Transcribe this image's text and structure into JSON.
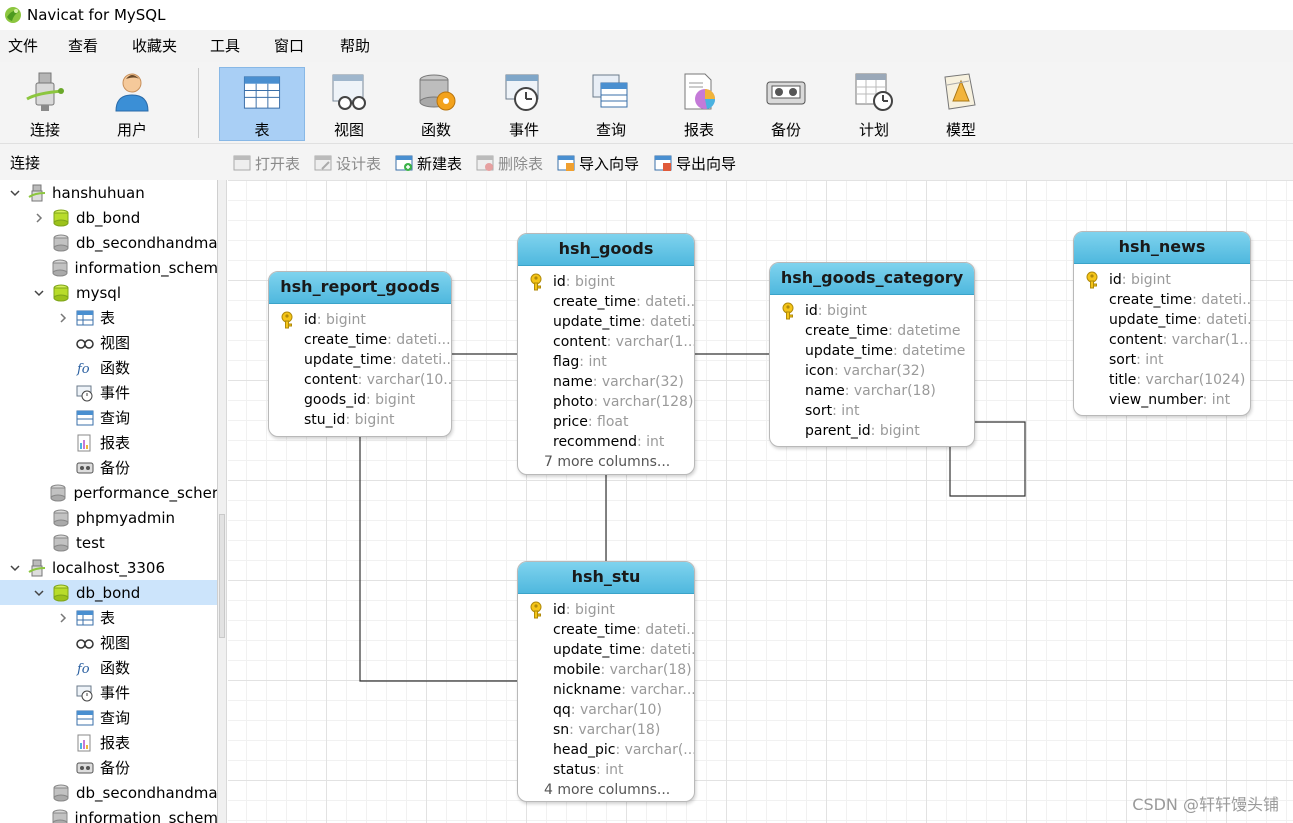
{
  "window": {
    "title": "Navicat for MySQL"
  },
  "menu": [
    "文件",
    "查看",
    "收藏夹",
    "工具",
    "窗口",
    "帮助"
  ],
  "toolbar": [
    {
      "label": "连接",
      "icon": "connection-icon",
      "active": false
    },
    {
      "label": "用户",
      "icon": "user-icon",
      "active": false
    },
    {
      "label": "表",
      "icon": "table-icon",
      "active": true
    },
    {
      "label": "视图",
      "icon": "view-icon",
      "active": false
    },
    {
      "label": "函数",
      "icon": "function-icon",
      "active": false
    },
    {
      "label": "事件",
      "icon": "event-icon",
      "active": false
    },
    {
      "label": "查询",
      "icon": "query-icon",
      "active": false
    },
    {
      "label": "报表",
      "icon": "report-icon",
      "active": false
    },
    {
      "label": "备份",
      "icon": "backup-icon",
      "active": false
    },
    {
      "label": "计划",
      "icon": "schedule-icon",
      "active": false
    },
    {
      "label": "模型",
      "icon": "model-icon",
      "active": false
    }
  ],
  "subbar": {
    "connection_label": "连接",
    "actions": [
      {
        "label": "打开表",
        "enabled": false
      },
      {
        "label": "设计表",
        "enabled": false
      },
      {
        "label": "新建表",
        "enabled": true
      },
      {
        "label": "删除表",
        "enabled": false
      },
      {
        "label": "导入向导",
        "enabled": true
      },
      {
        "label": "导出向导",
        "enabled": true
      }
    ]
  },
  "tree": [
    {
      "label": "hanshuhuan",
      "type": "connection",
      "arrow": "down"
    },
    {
      "label": "db_bond",
      "type": "db-open",
      "arrow": "right"
    },
    {
      "label": "db_secondhandma",
      "type": "db",
      "arrow": ""
    },
    {
      "label": "information_schem",
      "type": "db",
      "arrow": ""
    },
    {
      "label": "mysql",
      "type": "db-open",
      "arrow": "down"
    },
    {
      "label": "表",
      "type": "table",
      "arrow": "right"
    },
    {
      "label": "视图",
      "type": "view",
      "arrow": ""
    },
    {
      "label": "函数",
      "type": "function",
      "arrow": ""
    },
    {
      "label": "事件",
      "type": "event",
      "arrow": ""
    },
    {
      "label": "查询",
      "type": "query",
      "arrow": ""
    },
    {
      "label": "报表",
      "type": "report",
      "arrow": ""
    },
    {
      "label": "备份",
      "type": "backup",
      "arrow": ""
    },
    {
      "label": "performance_scher",
      "type": "db",
      "arrow": ""
    },
    {
      "label": "phpmyadmin",
      "type": "db",
      "arrow": ""
    },
    {
      "label": "test",
      "type": "db",
      "arrow": ""
    },
    {
      "label": "localhost_3306",
      "type": "connection",
      "arrow": "down"
    },
    {
      "label": "db_bond",
      "type": "db-open",
      "arrow": "down",
      "selected": true
    },
    {
      "label": "表",
      "type": "table",
      "arrow": "right"
    },
    {
      "label": "视图",
      "type": "view",
      "arrow": ""
    },
    {
      "label": "函数",
      "type": "function",
      "arrow": ""
    },
    {
      "label": "事件",
      "type": "event",
      "arrow": ""
    },
    {
      "label": "查询",
      "type": "query",
      "arrow": ""
    },
    {
      "label": "报表",
      "type": "report",
      "arrow": ""
    },
    {
      "label": "备份",
      "type": "backup",
      "arrow": ""
    },
    {
      "label": "db_secondhandma",
      "type": "db",
      "arrow": ""
    },
    {
      "label": "information_schem",
      "type": "db",
      "arrow": ""
    }
  ],
  "entities": [
    {
      "name": "hsh_report_goods",
      "fields": [
        {
          "name": "id",
          "type": ": bigint",
          "key": true
        },
        {
          "name": "create_time",
          "type": ": dateti...",
          "key": false
        },
        {
          "name": "update_time",
          "type": ": dateti...",
          "key": false
        },
        {
          "name": "content",
          "type": ": varchar(10...",
          "key": false
        },
        {
          "name": "goods_id",
          "type": ": bigint",
          "key": false
        },
        {
          "name": "stu_id",
          "type": ": bigint",
          "key": false
        }
      ],
      "more": ""
    },
    {
      "name": "hsh_goods",
      "fields": [
        {
          "name": "id",
          "type": ": bigint",
          "key": true
        },
        {
          "name": "create_time",
          "type": ": dateti...",
          "key": false
        },
        {
          "name": "update_time",
          "type": ": dateti...",
          "key": false
        },
        {
          "name": "content",
          "type": ": varchar(1...",
          "key": false
        },
        {
          "name": "flag",
          "type": ": int",
          "key": false
        },
        {
          "name": "name",
          "type": ": varchar(32)",
          "key": false
        },
        {
          "name": "photo",
          "type": ": varchar(128)",
          "key": false
        },
        {
          "name": "price",
          "type": ": float",
          "key": false
        },
        {
          "name": "recommend",
          "type": ": int",
          "key": false
        }
      ],
      "more": "7 more columns..."
    },
    {
      "name": "hsh_goods_category",
      "fields": [
        {
          "name": "id",
          "type": ": bigint",
          "key": true
        },
        {
          "name": "create_time",
          "type": ": datetime",
          "key": false
        },
        {
          "name": "update_time",
          "type": ": datetime",
          "key": false
        },
        {
          "name": "icon",
          "type": ": varchar(32)",
          "key": false
        },
        {
          "name": "name",
          "type": ": varchar(18)",
          "key": false
        },
        {
          "name": "sort",
          "type": ": int",
          "key": false
        },
        {
          "name": "parent_id",
          "type": ": bigint",
          "key": false
        }
      ],
      "more": ""
    },
    {
      "name": "hsh_news",
      "fields": [
        {
          "name": "id",
          "type": ": bigint",
          "key": true
        },
        {
          "name": "create_time",
          "type": ": dateti...",
          "key": false
        },
        {
          "name": "update_time",
          "type": ": dateti...",
          "key": false
        },
        {
          "name": "content",
          "type": ": varchar(1...",
          "key": false
        },
        {
          "name": "sort",
          "type": ": int",
          "key": false
        },
        {
          "name": "title",
          "type": ": varchar(1024)",
          "key": false
        },
        {
          "name": "view_number",
          "type": ": int",
          "key": false
        }
      ],
      "more": ""
    },
    {
      "name": "hsh_stu",
      "fields": [
        {
          "name": "id",
          "type": ": bigint",
          "key": true
        },
        {
          "name": "create_time",
          "type": ": dateti...",
          "key": false
        },
        {
          "name": "update_time",
          "type": ": dateti...",
          "key": false
        },
        {
          "name": "mobile",
          "type": ": varchar(18)",
          "key": false
        },
        {
          "name": "nickname",
          "type": ": varchar...",
          "key": false
        },
        {
          "name": "qq",
          "type": ": varchar(10)",
          "key": false
        },
        {
          "name": "sn",
          "type": ": varchar(18)",
          "key": false
        },
        {
          "name": "head_pic",
          "type": ": varchar(...",
          "key": false
        },
        {
          "name": "status",
          "type": ": int",
          "key": false
        }
      ],
      "more": "4 more columns..."
    }
  ],
  "watermark": "CSDN @轩轩馒头铺",
  "colors": {
    "entity_header": "#4fb8de",
    "active_tool": "#a9cff5",
    "selected_row": "#cce4fb",
    "relation_line": "#333333"
  }
}
